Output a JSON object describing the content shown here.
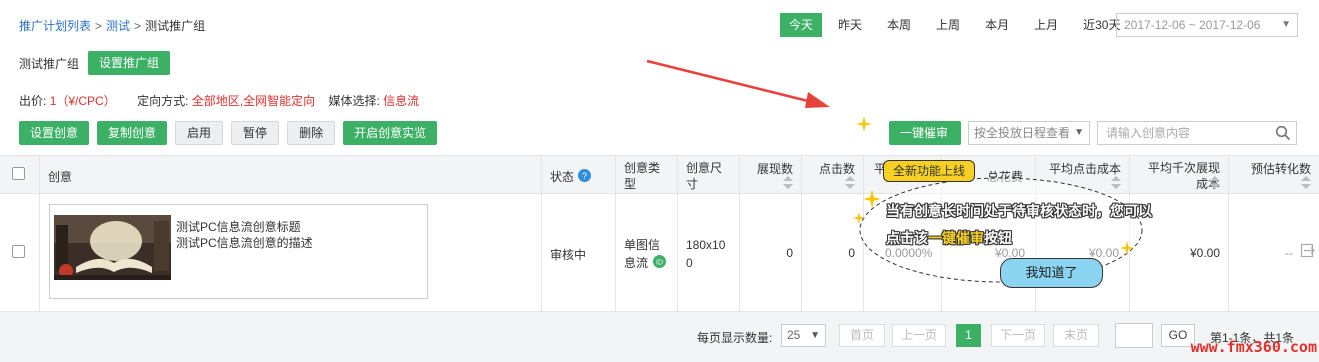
{
  "breadcrumb": {
    "item1": "推广计划列表",
    "sep1": ">",
    "item2": "测试",
    "sep2": ">",
    "item3": "测试推广组"
  },
  "date_tabs": [
    "今天",
    "昨天",
    "本周",
    "上周",
    "本月",
    "上月",
    "近30天"
  ],
  "date_range": "2017-12-06 ~ 2017-12-06",
  "group": {
    "name": "测试推广组",
    "set_button": "设置推广组"
  },
  "bid": {
    "label": "出价:",
    "value": "1（¥/CPC）",
    "targeting_label": "定向方式:",
    "targeting_value": "全部地区,全网智能定向",
    "media_label": "媒体选择:",
    "media_value": "信息流"
  },
  "toolbar": {
    "set": "设置创意",
    "copy": "复制创意",
    "enable": "启用",
    "pause": "暂停",
    "delete": "删除",
    "realview": "开启创意实览"
  },
  "one_key": "一键催审",
  "schedule_select": "按全投放日程查看",
  "search_placeholder": "请输入创意内容",
  "table": {
    "headers": {
      "creative": "创意",
      "status": "状态",
      "ctype": "创意类型",
      "csize": "创意尺寸",
      "impr": "展现数",
      "clicks": "点击数",
      "avg_rank": "平",
      "cost": "总花费",
      "avg_click": "平均点击成本",
      "avg_cpm": "平均千次展现成本",
      "conv": "预估转化数"
    },
    "row": {
      "title": "测试PC信息流创意标题",
      "desc": "测试PC信息流创意的描述",
      "status": "审核中",
      "ctype": "单图信息流",
      "csize": "180x100",
      "impr": "0",
      "clicks": "0",
      "ctr": "0.0000%",
      "cost": "¥0.00",
      "avg_click": "¥0.00",
      "avg_cpm": "¥0.00",
      "conv": "--"
    }
  },
  "footer": {
    "per_page_label": "每页显示数量:",
    "per_page": "25",
    "first": "首页",
    "prev": "上一页",
    "current": "1",
    "next": "下一页",
    "last": "末页",
    "go": "GO",
    "summary": "第1-1条，共1条"
  },
  "callout": {
    "new_feature": "全新功能上线",
    "line1": "当有创意长时间处于待审核状态时，您可以",
    "line2_pre": "点击该",
    "line2_hl": "一键催审",
    "line2_post": "按钮",
    "got_it": "我知道了"
  },
  "watermark": "www.fmx360.com",
  "colors": {
    "green": "#3cb064",
    "red": "#e0312d",
    "link": "#2a72c5",
    "yellow": "#f7d023",
    "blue_tip": "#8ad4f2"
  }
}
